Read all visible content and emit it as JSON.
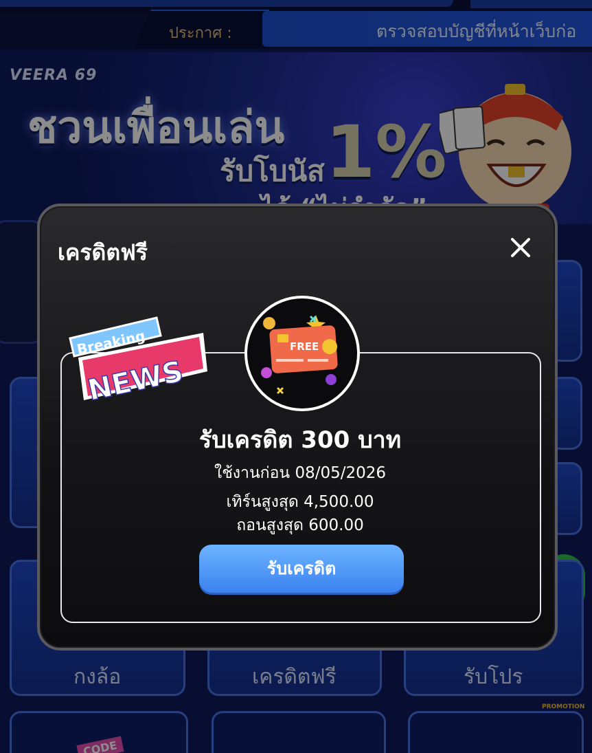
{
  "announcement": {
    "label": "ประกาศ :",
    "marquee": "ตรวจสอบบัญชีที่หน้าเว็บก่อ"
  },
  "banner": {
    "brand": "VEERA 69",
    "headline": "ชวนเพื่อนเล่น",
    "sub": "รับโบนัส",
    "percent": "1%",
    "bottom": "ได้ “ไม่จำกัด”"
  },
  "background_menu": {
    "items": [
      {
        "label": "กงล้อ"
      },
      {
        "label": "เครดิตฟรี"
      },
      {
        "label": "รับโปร"
      }
    ],
    "bottom_row_badge": "CODE",
    "promotion_badge": "PROMOTION"
  },
  "modal": {
    "title": "เครดิตฟรี",
    "close_label": "✕",
    "icon_text": "FREE",
    "reward_title": "รับเครดิต 300 บาท",
    "expire": "ใช้งานก่อน 08/05/2026",
    "turnover": "เทิร์นสูงสุด 4,500.00",
    "withdraw": "ถอนสูงสุด 600.00",
    "claim_button": "รับเครดิต"
  },
  "sticker": {
    "line1": "Breaking",
    "line2": "NEWS"
  },
  "colors": {
    "accent_blue": "#3b82f0",
    "announce_gold": "#e8c079",
    "app_bg": "#0d1a5a",
    "modal_bg": "#121214"
  }
}
